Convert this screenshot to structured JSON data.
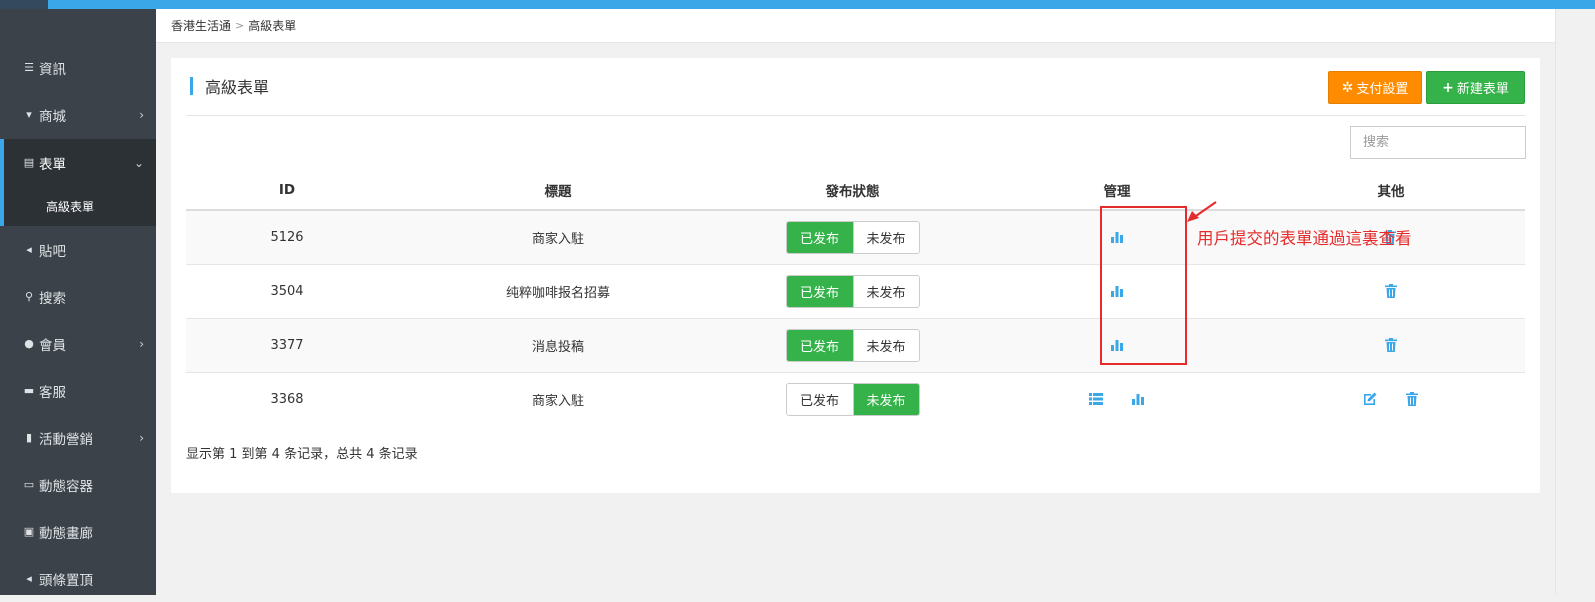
{
  "sidebar": {
    "items": [
      {
        "label": "資訊",
        "icon": "list-icon"
      },
      {
        "label": "商城",
        "icon": "cart-icon"
      },
      {
        "label": "表單",
        "icon": "form-icon"
      },
      {
        "label": "貼吧",
        "icon": "megaphone-icon"
      },
      {
        "label": "搜索",
        "icon": "search-icon"
      },
      {
        "label": "會員",
        "icon": "bell-icon"
      },
      {
        "label": "客服",
        "icon": "chat-icon"
      },
      {
        "label": "活動營銷",
        "icon": "bookmark-icon"
      },
      {
        "label": "動態容器",
        "icon": "inbox-icon"
      },
      {
        "label": "動態畫廊",
        "icon": "picture-icon"
      },
      {
        "label": "頭條置頂",
        "icon": "volume-icon"
      }
    ],
    "sub_item": "高級表單"
  },
  "breadcrumb": {
    "root": "香港生活通",
    "current": "高級表單"
  },
  "panel": {
    "title": "高級表單",
    "pay_button": "支付設置",
    "new_button": "新建表單",
    "search_placeholder": "搜索"
  },
  "table": {
    "headers": [
      "ID",
      "標題",
      "發布狀態",
      "管理",
      "其他"
    ],
    "toggle_labels": {
      "published": "已发布",
      "unpublished": "未发布"
    },
    "rows": [
      {
        "id": "5126",
        "title": "商家入駐",
        "status": "published"
      },
      {
        "id": "3504",
        "title": "纯粹咖啡报名招募",
        "status": "published"
      },
      {
        "id": "3377",
        "title": "消息投稿",
        "status": "published"
      },
      {
        "id": "3368",
        "title": "商家入駐",
        "status": "unpublished"
      }
    ]
  },
  "footer_text": "显示第 1 到第 4 条记录，总共 4 条记录",
  "annotation": "用戶提交的表單通過這裏查看",
  "colors": {
    "accent": "#3aa8e8",
    "green": "#35b34a",
    "orange": "#ff8c00",
    "red": "#e52b2b",
    "sidebar": "#3b4249"
  }
}
